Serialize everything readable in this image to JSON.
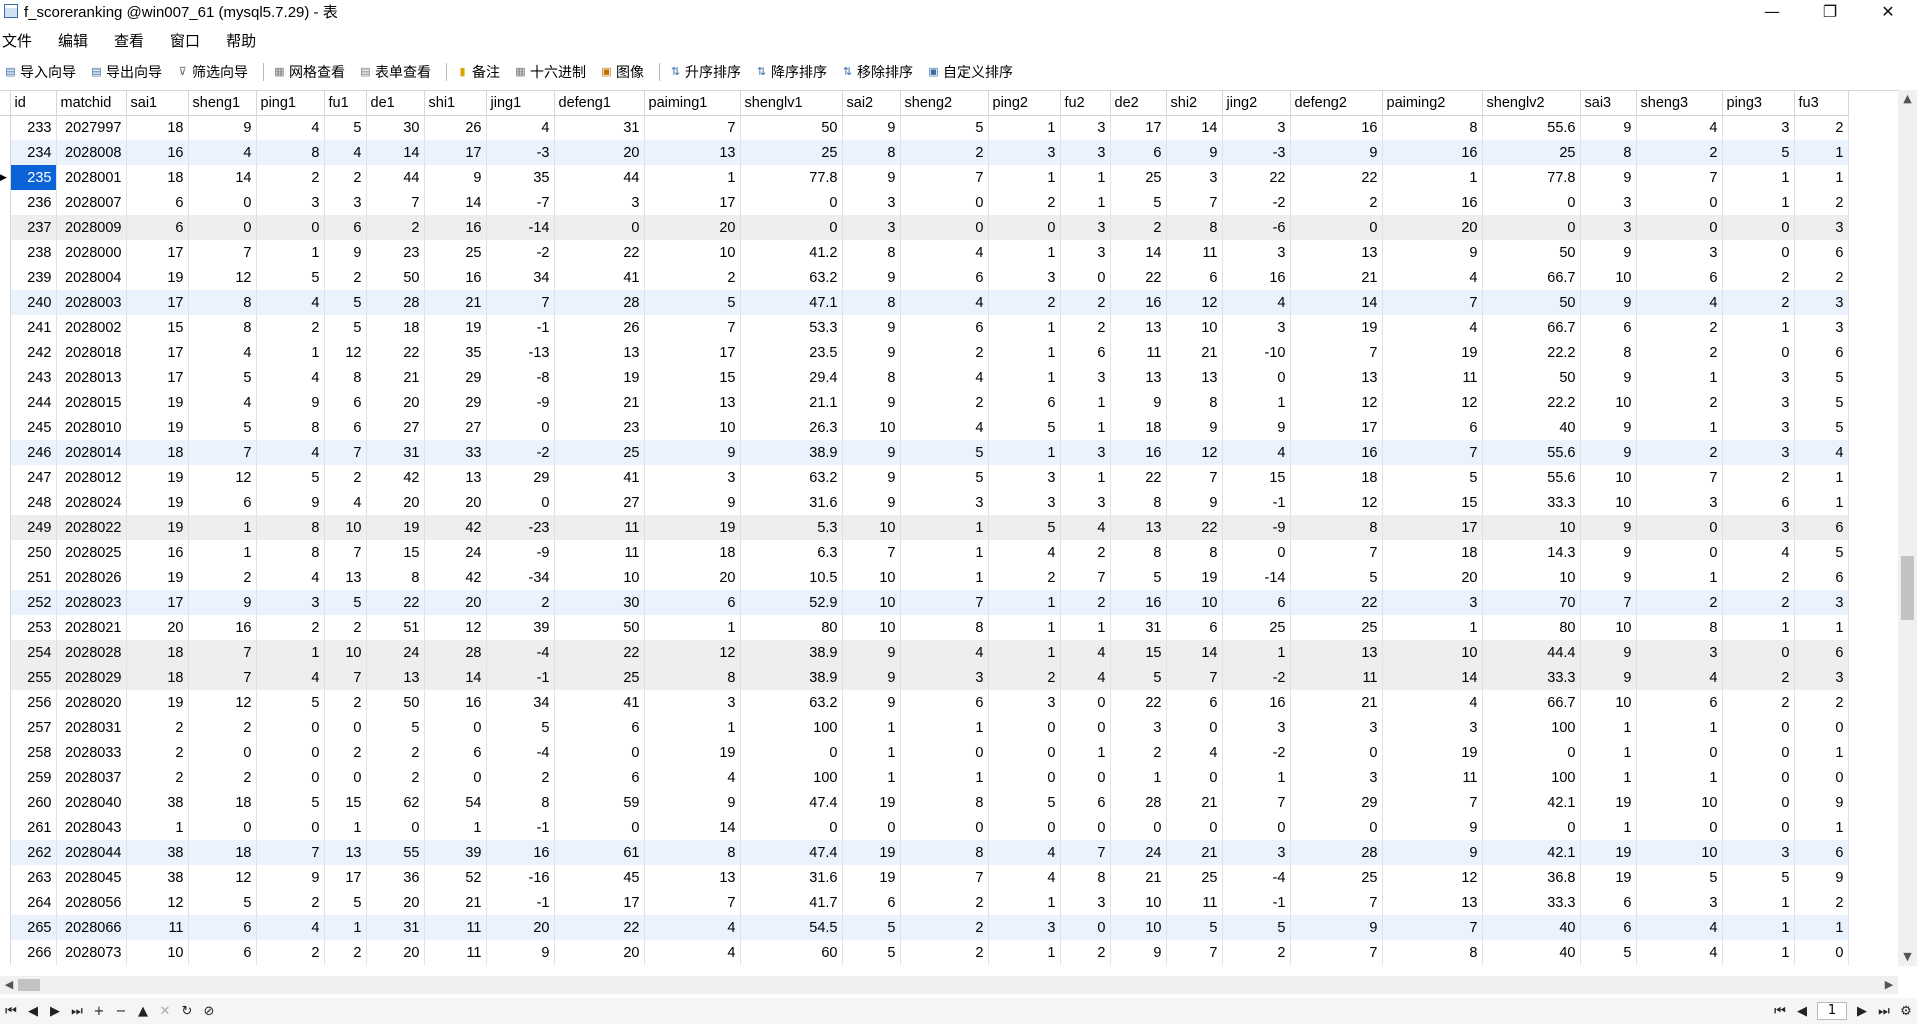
{
  "window": {
    "title": "f_scoreranking @win007_61 (mysql5.7.29) - 表",
    "minimize": "—",
    "restore": "❐",
    "close": "✕"
  },
  "menu": [
    "文件",
    "编辑",
    "查看",
    "窗口",
    "帮助"
  ],
  "toolbar": [
    {
      "label": "导入向导",
      "icon": "import-icon"
    },
    {
      "label": "导出向导",
      "icon": "export-icon"
    },
    {
      "label": "筛选向导",
      "icon": "filter-icon"
    },
    {
      "label": "网格查看",
      "icon": "grid-view-icon"
    },
    {
      "label": "表单查看",
      "icon": "form-view-icon"
    },
    {
      "label": "备注",
      "icon": "memo-icon"
    },
    {
      "label": "十六进制",
      "icon": "hex-icon"
    },
    {
      "label": "图像",
      "icon": "image-icon"
    },
    {
      "label": "升序排序",
      "icon": "sort-asc-icon"
    },
    {
      "label": "降序排序",
      "icon": "sort-desc-icon"
    },
    {
      "label": "移除排序",
      "icon": "remove-sort-icon"
    },
    {
      "label": "自定义排序",
      "icon": "custom-sort-icon"
    }
  ],
  "columns": [
    "id",
    "matchid",
    "sai1",
    "sheng1",
    "ping1",
    "fu1",
    "de1",
    "shi1",
    "jing1",
    "defeng1",
    "paiming1",
    "shenglv1",
    "sai2",
    "sheng2",
    "ping2",
    "fu2",
    "de2",
    "shi2",
    "jing2",
    "defeng2",
    "paiming2",
    "shenglv2",
    "sai3",
    "sheng3",
    "ping3",
    "fu3"
  ],
  "rows": [
    [
      "233",
      "2027997",
      "18",
      "9",
      "4",
      "5",
      "30",
      "26",
      "4",
      "31",
      "7",
      "50",
      "9",
      "5",
      "1",
      "3",
      "17",
      "14",
      "3",
      "16",
      "8",
      "55.6",
      "9",
      "4",
      "3",
      "2"
    ],
    [
      "234",
      "2028008",
      "16",
      "4",
      "8",
      "4",
      "14",
      "17",
      "-3",
      "20",
      "13",
      "25",
      "8",
      "2",
      "3",
      "3",
      "6",
      "9",
      "-3",
      "9",
      "16",
      "25",
      "8",
      "2",
      "5",
      "1"
    ],
    [
      "235",
      "2028001",
      "18",
      "14",
      "2",
      "2",
      "44",
      "9",
      "35",
      "44",
      "1",
      "77.8",
      "9",
      "7",
      "1",
      "1",
      "25",
      "3",
      "22",
      "22",
      "1",
      "77.8",
      "9",
      "7",
      "1",
      "1"
    ],
    [
      "236",
      "2028007",
      "6",
      "0",
      "3",
      "3",
      "7",
      "14",
      "-7",
      "3",
      "17",
      "0",
      "3",
      "0",
      "2",
      "1",
      "5",
      "7",
      "-2",
      "2",
      "16",
      "0",
      "3",
      "0",
      "1",
      "2"
    ],
    [
      "237",
      "2028009",
      "6",
      "0",
      "0",
      "6",
      "2",
      "16",
      "-14",
      "0",
      "20",
      "0",
      "3",
      "0",
      "0",
      "3",
      "2",
      "8",
      "-6",
      "0",
      "20",
      "0",
      "3",
      "0",
      "0",
      "3"
    ],
    [
      "238",
      "2028000",
      "17",
      "7",
      "1",
      "9",
      "23",
      "25",
      "-2",
      "22",
      "10",
      "41.2",
      "8",
      "4",
      "1",
      "3",
      "14",
      "11",
      "3",
      "13",
      "9",
      "50",
      "9",
      "3",
      "0",
      "6"
    ],
    [
      "239",
      "2028004",
      "19",
      "12",
      "5",
      "2",
      "50",
      "16",
      "34",
      "41",
      "2",
      "63.2",
      "9",
      "6",
      "3",
      "0",
      "22",
      "6",
      "16",
      "21",
      "4",
      "66.7",
      "10",
      "6",
      "2",
      "2"
    ],
    [
      "240",
      "2028003",
      "17",
      "8",
      "4",
      "5",
      "28",
      "21",
      "7",
      "28",
      "5",
      "47.1",
      "8",
      "4",
      "2",
      "2",
      "16",
      "12",
      "4",
      "14",
      "7",
      "50",
      "9",
      "4",
      "2",
      "3"
    ],
    [
      "241",
      "2028002",
      "15",
      "8",
      "2",
      "5",
      "18",
      "19",
      "-1",
      "26",
      "7",
      "53.3",
      "9",
      "6",
      "1",
      "2",
      "13",
      "10",
      "3",
      "19",
      "4",
      "66.7",
      "6",
      "2",
      "1",
      "3"
    ],
    [
      "242",
      "2028018",
      "17",
      "4",
      "1",
      "12",
      "22",
      "35",
      "-13",
      "13",
      "17",
      "23.5",
      "9",
      "2",
      "1",
      "6",
      "11",
      "21",
      "-10",
      "7",
      "19",
      "22.2",
      "8",
      "2",
      "0",
      "6"
    ],
    [
      "243",
      "2028013",
      "17",
      "5",
      "4",
      "8",
      "21",
      "29",
      "-8",
      "19",
      "15",
      "29.4",
      "8",
      "4",
      "1",
      "3",
      "13",
      "13",
      "0",
      "13",
      "11",
      "50",
      "9",
      "1",
      "3",
      "5"
    ],
    [
      "244",
      "2028015",
      "19",
      "4",
      "9",
      "6",
      "20",
      "29",
      "-9",
      "21",
      "13",
      "21.1",
      "9",
      "2",
      "6",
      "1",
      "9",
      "8",
      "1",
      "12",
      "12",
      "22.2",
      "10",
      "2",
      "3",
      "5"
    ],
    [
      "245",
      "2028010",
      "19",
      "5",
      "8",
      "6",
      "27",
      "27",
      "0",
      "23",
      "10",
      "26.3",
      "10",
      "4",
      "5",
      "1",
      "18",
      "9",
      "9",
      "17",
      "6",
      "40",
      "9",
      "1",
      "3",
      "5"
    ],
    [
      "246",
      "2028014",
      "18",
      "7",
      "4",
      "7",
      "31",
      "33",
      "-2",
      "25",
      "9",
      "38.9",
      "9",
      "5",
      "1",
      "3",
      "16",
      "12",
      "4",
      "16",
      "7",
      "55.6",
      "9",
      "2",
      "3",
      "4"
    ],
    [
      "247",
      "2028012",
      "19",
      "12",
      "5",
      "2",
      "42",
      "13",
      "29",
      "41",
      "3",
      "63.2",
      "9",
      "5",
      "3",
      "1",
      "22",
      "7",
      "15",
      "18",
      "5",
      "55.6",
      "10",
      "7",
      "2",
      "1"
    ],
    [
      "248",
      "2028024",
      "19",
      "6",
      "9",
      "4",
      "20",
      "20",
      "0",
      "27",
      "9",
      "31.6",
      "9",
      "3",
      "3",
      "3",
      "8",
      "9",
      "-1",
      "12",
      "15",
      "33.3",
      "10",
      "3",
      "6",
      "1"
    ],
    [
      "249",
      "2028022",
      "19",
      "1",
      "8",
      "10",
      "19",
      "42",
      "-23",
      "11",
      "19",
      "5.3",
      "10",
      "1",
      "5",
      "4",
      "13",
      "22",
      "-9",
      "8",
      "17",
      "10",
      "9",
      "0",
      "3",
      "6"
    ],
    [
      "250",
      "2028025",
      "16",
      "1",
      "8",
      "7",
      "15",
      "24",
      "-9",
      "11",
      "18",
      "6.3",
      "7",
      "1",
      "4",
      "2",
      "8",
      "8",
      "0",
      "7",
      "18",
      "14.3",
      "9",
      "0",
      "4",
      "5"
    ],
    [
      "251",
      "2028026",
      "19",
      "2",
      "4",
      "13",
      "8",
      "42",
      "-34",
      "10",
      "20",
      "10.5",
      "10",
      "1",
      "2",
      "7",
      "5",
      "19",
      "-14",
      "5",
      "20",
      "10",
      "9",
      "1",
      "2",
      "6"
    ],
    [
      "252",
      "2028023",
      "17",
      "9",
      "3",
      "5",
      "22",
      "20",
      "2",
      "30",
      "6",
      "52.9",
      "10",
      "7",
      "1",
      "2",
      "16",
      "10",
      "6",
      "22",
      "3",
      "70",
      "7",
      "2",
      "2",
      "3"
    ],
    [
      "253",
      "2028021",
      "20",
      "16",
      "2",
      "2",
      "51",
      "12",
      "39",
      "50",
      "1",
      "80",
      "10",
      "8",
      "1",
      "1",
      "31",
      "6",
      "25",
      "25",
      "1",
      "80",
      "10",
      "8",
      "1",
      "1"
    ],
    [
      "254",
      "2028028",
      "18",
      "7",
      "1",
      "10",
      "24",
      "28",
      "-4",
      "22",
      "12",
      "38.9",
      "9",
      "4",
      "1",
      "4",
      "15",
      "14",
      "1",
      "13",
      "10",
      "44.4",
      "9",
      "3",
      "0",
      "6"
    ],
    [
      "255",
      "2028029",
      "18",
      "7",
      "4",
      "7",
      "13",
      "14",
      "-1",
      "25",
      "8",
      "38.9",
      "9",
      "3",
      "2",
      "4",
      "5",
      "7",
      "-2",
      "11",
      "14",
      "33.3",
      "9",
      "4",
      "2",
      "3"
    ],
    [
      "256",
      "2028020",
      "19",
      "12",
      "5",
      "2",
      "50",
      "16",
      "34",
      "41",
      "3",
      "63.2",
      "9",
      "6",
      "3",
      "0",
      "22",
      "6",
      "16",
      "21",
      "4",
      "66.7",
      "10",
      "6",
      "2",
      "2"
    ],
    [
      "257",
      "2028031",
      "2",
      "2",
      "0",
      "0",
      "5",
      "0",
      "5",
      "6",
      "1",
      "100",
      "1",
      "1",
      "0",
      "0",
      "3",
      "0",
      "3",
      "3",
      "3",
      "100",
      "1",
      "1",
      "0",
      "0"
    ],
    [
      "258",
      "2028033",
      "2",
      "0",
      "0",
      "2",
      "2",
      "6",
      "-4",
      "0",
      "19",
      "0",
      "1",
      "0",
      "0",
      "1",
      "2",
      "4",
      "-2",
      "0",
      "19",
      "0",
      "1",
      "0",
      "0",
      "1"
    ],
    [
      "259",
      "2028037",
      "2",
      "2",
      "0",
      "0",
      "2",
      "0",
      "2",
      "6",
      "4",
      "100",
      "1",
      "1",
      "0",
      "0",
      "1",
      "0",
      "1",
      "3",
      "11",
      "100",
      "1",
      "1",
      "0",
      "0"
    ],
    [
      "260",
      "2028040",
      "38",
      "18",
      "5",
      "15",
      "62",
      "54",
      "8",
      "59",
      "9",
      "47.4",
      "19",
      "8",
      "5",
      "6",
      "28",
      "21",
      "7",
      "29",
      "7",
      "42.1",
      "19",
      "10",
      "0",
      "9"
    ],
    [
      "261",
      "2028043",
      "1",
      "0",
      "0",
      "1",
      "0",
      "1",
      "-1",
      "0",
      "14",
      "0",
      "0",
      "0",
      "0",
      "0",
      "0",
      "0",
      "0",
      "0",
      "9",
      "0",
      "1",
      "0",
      "0",
      "1"
    ],
    [
      "262",
      "2028044",
      "38",
      "18",
      "7",
      "13",
      "55",
      "39",
      "16",
      "61",
      "8",
      "47.4",
      "19",
      "8",
      "4",
      "7",
      "24",
      "21",
      "3",
      "28",
      "9",
      "42.1",
      "19",
      "10",
      "3",
      "6"
    ],
    [
      "263",
      "2028045",
      "38",
      "12",
      "9",
      "17",
      "36",
      "52",
      "-16",
      "45",
      "13",
      "31.6",
      "19",
      "7",
      "4",
      "8",
      "21",
      "25",
      "-4",
      "25",
      "12",
      "36.8",
      "19",
      "5",
      "5",
      "9"
    ],
    [
      "264",
      "2028056",
      "12",
      "5",
      "2",
      "5",
      "20",
      "21",
      "-1",
      "17",
      "7",
      "41.7",
      "6",
      "2",
      "1",
      "3",
      "10",
      "11",
      "-1",
      "7",
      "13",
      "33.3",
      "6",
      "3",
      "1",
      "2"
    ],
    [
      "265",
      "2028066",
      "11",
      "6",
      "4",
      "1",
      "31",
      "11",
      "20",
      "22",
      "4",
      "54.5",
      "5",
      "2",
      "3",
      "0",
      "10",
      "5",
      "5",
      "9",
      "7",
      "40",
      "6",
      "4",
      "1",
      "1"
    ],
    [
      "266",
      "2028073",
      "10",
      "6",
      "2",
      "2",
      "20",
      "11",
      "9",
      "20",
      "4",
      "60",
      "5",
      "2",
      "1",
      "2",
      "9",
      "7",
      "2",
      "7",
      "8",
      "40",
      "5",
      "4",
      "1",
      "0"
    ]
  ],
  "selected_row_id": "235",
  "row_styles": [
    "n",
    "hl",
    "n",
    "n",
    "alt",
    "n",
    "n",
    "hl",
    "n",
    "n",
    "n",
    "n",
    "n",
    "hl",
    "n",
    "n",
    "alt",
    "n",
    "n",
    "hl",
    "n",
    "alt",
    "alt",
    "n",
    "n",
    "n",
    "n",
    "n",
    "n",
    "hl",
    "n",
    "n",
    "hl",
    "n"
  ],
  "pagination": {
    "page": "1"
  }
}
